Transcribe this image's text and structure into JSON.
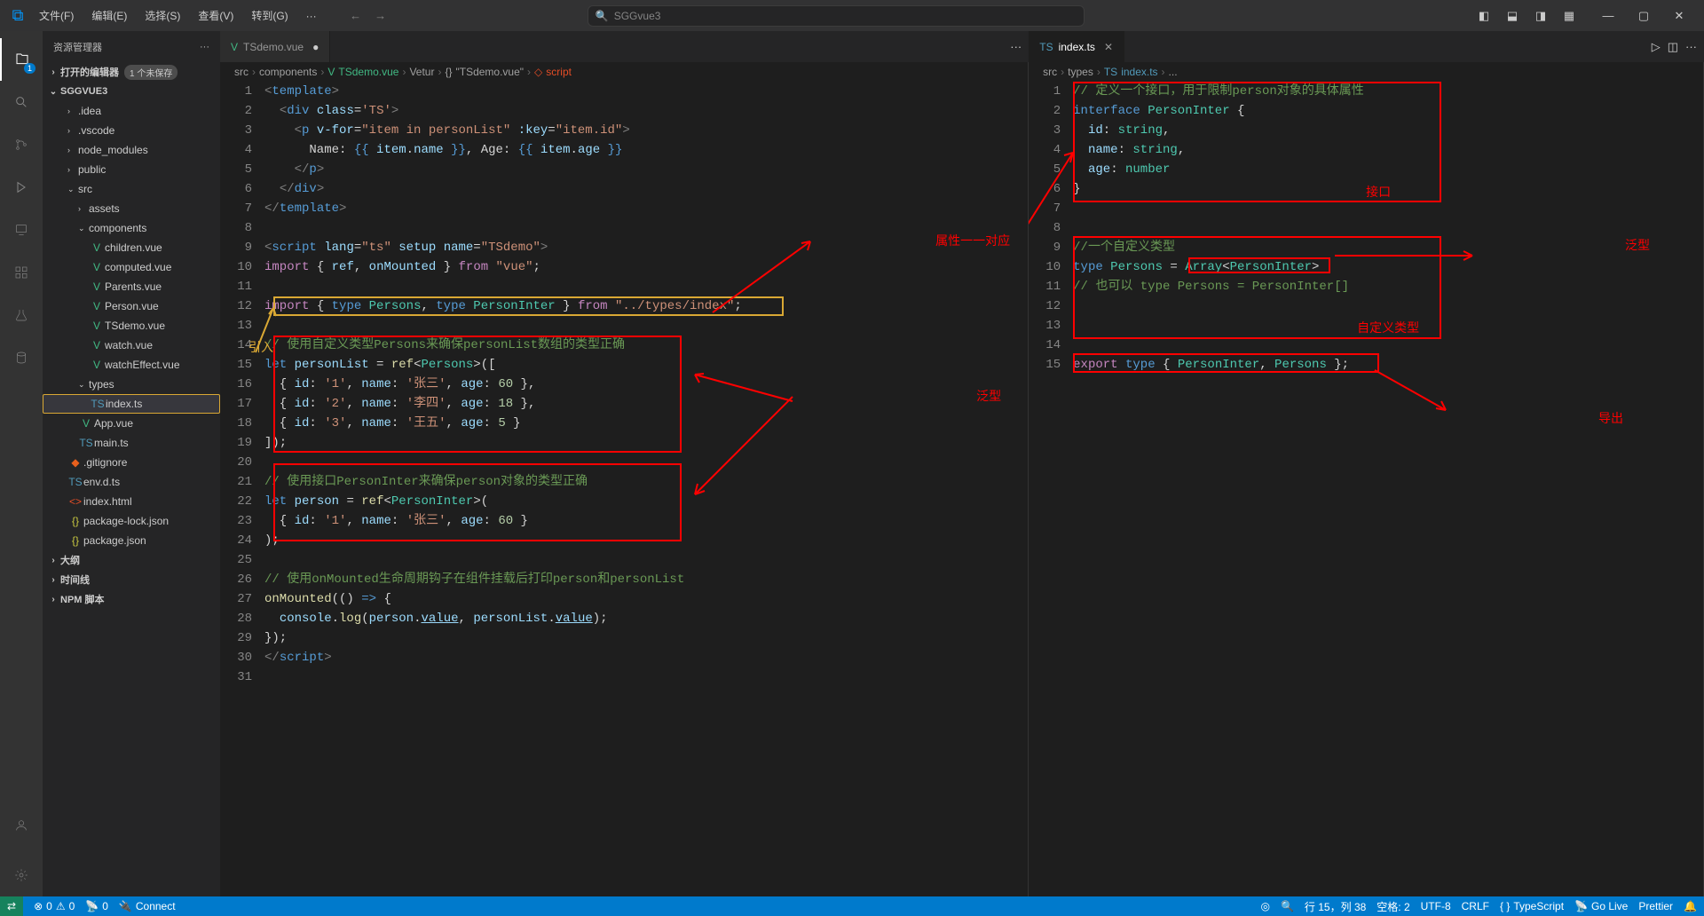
{
  "titlebar": {
    "menus": [
      "文件(F)",
      "编辑(E)",
      "选择(S)",
      "查看(V)",
      "转到(G)",
      "···"
    ],
    "search_text": "SGGvue3"
  },
  "sidebar": {
    "title": "资源管理器",
    "open_editors_label": "打开的编辑器",
    "open_editors_badge": "1 个未保存",
    "project": "SGGVUE3",
    "tree": [
      {
        "label": ".idea",
        "indent": 1,
        "chev": "›"
      },
      {
        "label": ".vscode",
        "indent": 1,
        "chev": "›"
      },
      {
        "label": "node_modules",
        "indent": 1,
        "chev": "›"
      },
      {
        "label": "public",
        "indent": 1,
        "chev": "›"
      },
      {
        "label": "src",
        "indent": 1,
        "chev": "⌄"
      },
      {
        "label": "assets",
        "indent": 2,
        "chev": "›"
      },
      {
        "label": "components",
        "indent": 2,
        "chev": "⌄"
      },
      {
        "label": "children.vue",
        "indent": 3,
        "icon": "V",
        "iclass": "fc-vue"
      },
      {
        "label": "computed.vue",
        "indent": 3,
        "icon": "V",
        "iclass": "fc-vue"
      },
      {
        "label": "Parents.vue",
        "indent": 3,
        "icon": "V",
        "iclass": "fc-vue"
      },
      {
        "label": "Person.vue",
        "indent": 3,
        "icon": "V",
        "iclass": "fc-vue"
      },
      {
        "label": "TSdemo.vue",
        "indent": 3,
        "icon": "V",
        "iclass": "fc-vue"
      },
      {
        "label": "watch.vue",
        "indent": 3,
        "icon": "V",
        "iclass": "fc-vue"
      },
      {
        "label": "watchEffect.vue",
        "indent": 3,
        "icon": "V",
        "iclass": "fc-vue"
      },
      {
        "label": "types",
        "indent": 2,
        "chev": "⌄"
      },
      {
        "label": "index.ts",
        "indent": 3,
        "icon": "TS",
        "iclass": "fc-ts",
        "selected": true
      },
      {
        "label": "App.vue",
        "indent": 2,
        "icon": "V",
        "iclass": "fc-vue"
      },
      {
        "label": "main.ts",
        "indent": 2,
        "icon": "TS",
        "iclass": "fc-ts"
      },
      {
        "label": ".gitignore",
        "indent": 1,
        "icon": "◆",
        "iclass": "fc-git"
      },
      {
        "label": "env.d.ts",
        "indent": 1,
        "icon": "TS",
        "iclass": "fc-ts"
      },
      {
        "label": "index.html",
        "indent": 1,
        "icon": "<>",
        "iclass": "fc-html"
      },
      {
        "label": "package-lock.json",
        "indent": 1,
        "icon": "{}",
        "iclass": "fc-json"
      },
      {
        "label": "package.json",
        "indent": 1,
        "icon": "{}",
        "iclass": "fc-json"
      }
    ],
    "outline": "大纲",
    "timeline": "时间线",
    "npm_scripts": "NPM 脚本"
  },
  "tabs": {
    "left": {
      "icon": "V",
      "iclass": "fc-vue",
      "label": "TSdemo.vue",
      "dirty": true
    },
    "right": {
      "icon": "TS",
      "iclass": "fc-ts",
      "label": "index.ts",
      "active": true
    }
  },
  "breadcrumbs": {
    "left": [
      "src",
      "components",
      "TSdemo.vue",
      "Vetur",
      "{}",
      "\"TSdemo.vue\"",
      "script"
    ],
    "right": [
      "src",
      "types",
      "index.ts",
      "..."
    ]
  },
  "code_left_lines": 31,
  "code_right_lines": 15,
  "annotations": {
    "yinru": "引入",
    "shuxing": "属性一一对应",
    "fanxing": "泛型",
    "jiekou": "接口",
    "zidingyi": "自定义类型",
    "daochu": "导出",
    "fanxing2": "泛型"
  },
  "statusbar": {
    "remote": "⇄",
    "errors": "0",
    "warnings": "0",
    "radio": "0",
    "connect": "Connect",
    "cursor": "行 15，列 38",
    "spaces": "空格: 2",
    "encoding": "UTF-8",
    "eol": "CRLF",
    "lang": "TypeScript",
    "golive": "Go Live",
    "prettier": "Prettier"
  }
}
